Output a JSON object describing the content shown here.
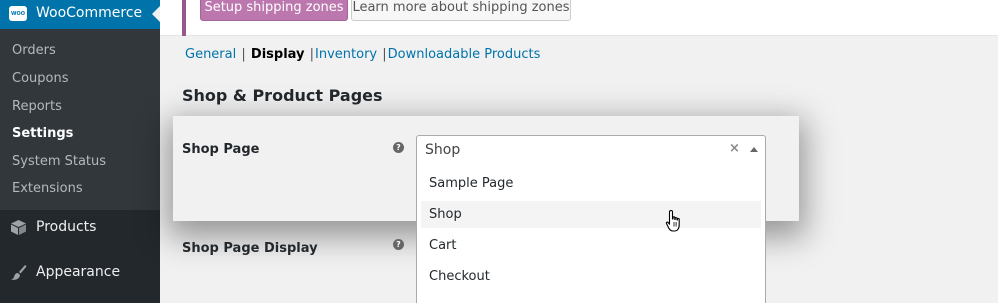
{
  "sidebar": {
    "top": {
      "label": "WooCommerce",
      "badge": "WOO",
      "icon": "woocommerce-icon"
    },
    "submenu": [
      {
        "label": "Orders"
      },
      {
        "label": "Coupons"
      },
      {
        "label": "Reports"
      },
      {
        "label": "Settings",
        "current": true
      },
      {
        "label": "System Status"
      },
      {
        "label": "Extensions"
      }
    ],
    "menu": [
      {
        "label": "Products",
        "icon": "products-box-icon"
      },
      {
        "label": "Appearance",
        "icon": "appearance-brush-icon"
      }
    ]
  },
  "notice": {
    "primary_button": "Setup shipping zones",
    "secondary_button": "Learn more about shipping zones",
    "accent": "#96588a"
  },
  "subnav": [
    {
      "label": "General"
    },
    {
      "label": "Display",
      "current": true
    },
    {
      "label": "Inventory"
    },
    {
      "label": "Downloadable Products"
    }
  ],
  "section_title": "Shop & Product Pages",
  "fields": {
    "shop_page": {
      "label": "Shop Page",
      "help": "?"
    },
    "shop_page_display": {
      "label": "Shop Page Display",
      "help": "?"
    }
  },
  "select": {
    "value": "Shop",
    "clear": "×",
    "options": [
      "Sample Page",
      "Shop",
      "Cart",
      "Checkout"
    ],
    "hovered": "Shop"
  },
  "colors": {
    "admin_blue": "#0073aa",
    "sidebar_dark": "#23282d",
    "submenu_dark": "#32373c",
    "woo_purple": "#bb77ae"
  }
}
